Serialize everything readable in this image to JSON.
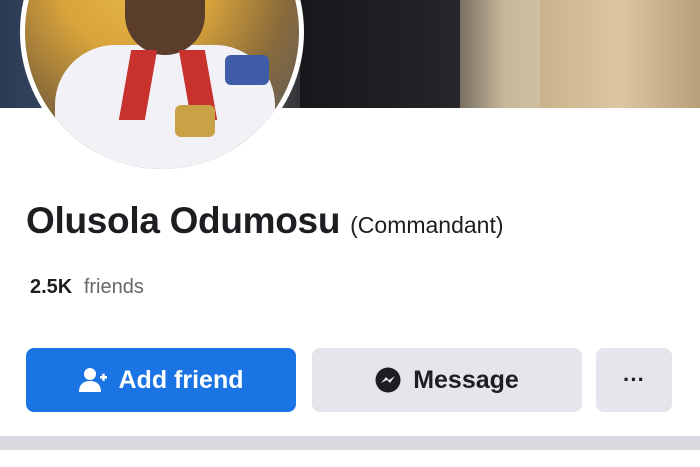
{
  "profile": {
    "name": "Olusola Odumosu",
    "title": "(Commandant)",
    "friends_count": "2.5K",
    "friends_label": "friends"
  },
  "actions": {
    "add_friend_label": "Add friend",
    "message_label": "Message",
    "more_label": "···"
  },
  "icons": {
    "add_friend": "person-add-icon",
    "message": "messenger-icon"
  },
  "colors": {
    "primary": "#1b74e4",
    "secondary_bg": "#e4e6eb",
    "text": "#1c1e21",
    "muted": "#65676b"
  }
}
